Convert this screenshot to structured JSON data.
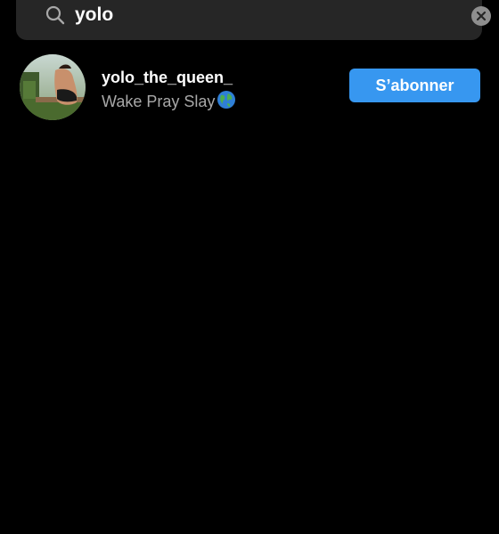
{
  "search": {
    "value": "yolo",
    "icon": "search-icon",
    "clear_icon": "clear-icon"
  },
  "results": [
    {
      "username": "yolo_the_queen_",
      "bio": "Wake Pray Slay",
      "bio_emoji": "globe-icon",
      "follow_label": "S’abonner",
      "avatar": "avatar-photo"
    }
  ],
  "colors": {
    "background": "#000000",
    "search_bg": "#262626",
    "accent": "#3797f0",
    "secondary_text": "#a8a8a8"
  }
}
